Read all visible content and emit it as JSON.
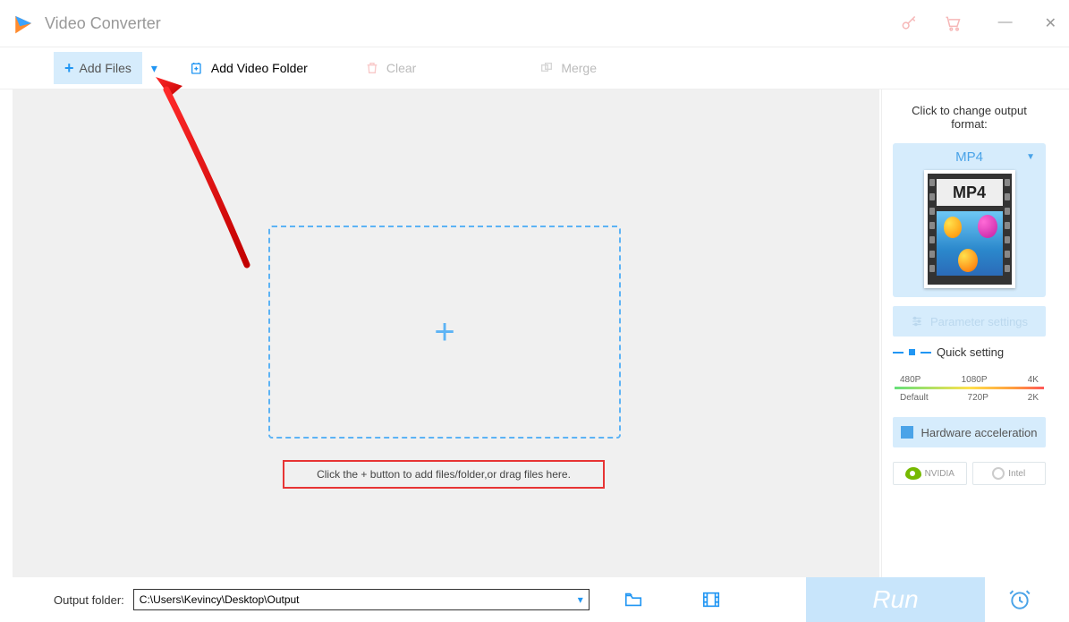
{
  "app": {
    "title": "Video Converter"
  },
  "toolbar": {
    "addFiles": "Add Files",
    "addFolder": "Add Video Folder",
    "clear": "Clear",
    "merge": "Merge"
  },
  "workspace": {
    "hint": "Click the + button to add files/folder,or drag files here."
  },
  "rightPanel": {
    "label": "Click to change output format:",
    "format": "MP4",
    "formatBadge": "MP4",
    "paramBtn": "Parameter settings",
    "quickSetting": "Quick setting",
    "sliderTop": {
      "a": "480P",
      "b": "1080P",
      "c": "4K"
    },
    "sliderBottom": {
      "a": "Default",
      "b": "720P",
      "c": "2K"
    },
    "hwAccel": "Hardware acceleration",
    "nvidia": "NVIDIA",
    "intel": "Intel"
  },
  "bottom": {
    "label": "Output folder:",
    "path": "C:\\Users\\Kevincy\\Desktop\\Output",
    "run": "Run"
  }
}
